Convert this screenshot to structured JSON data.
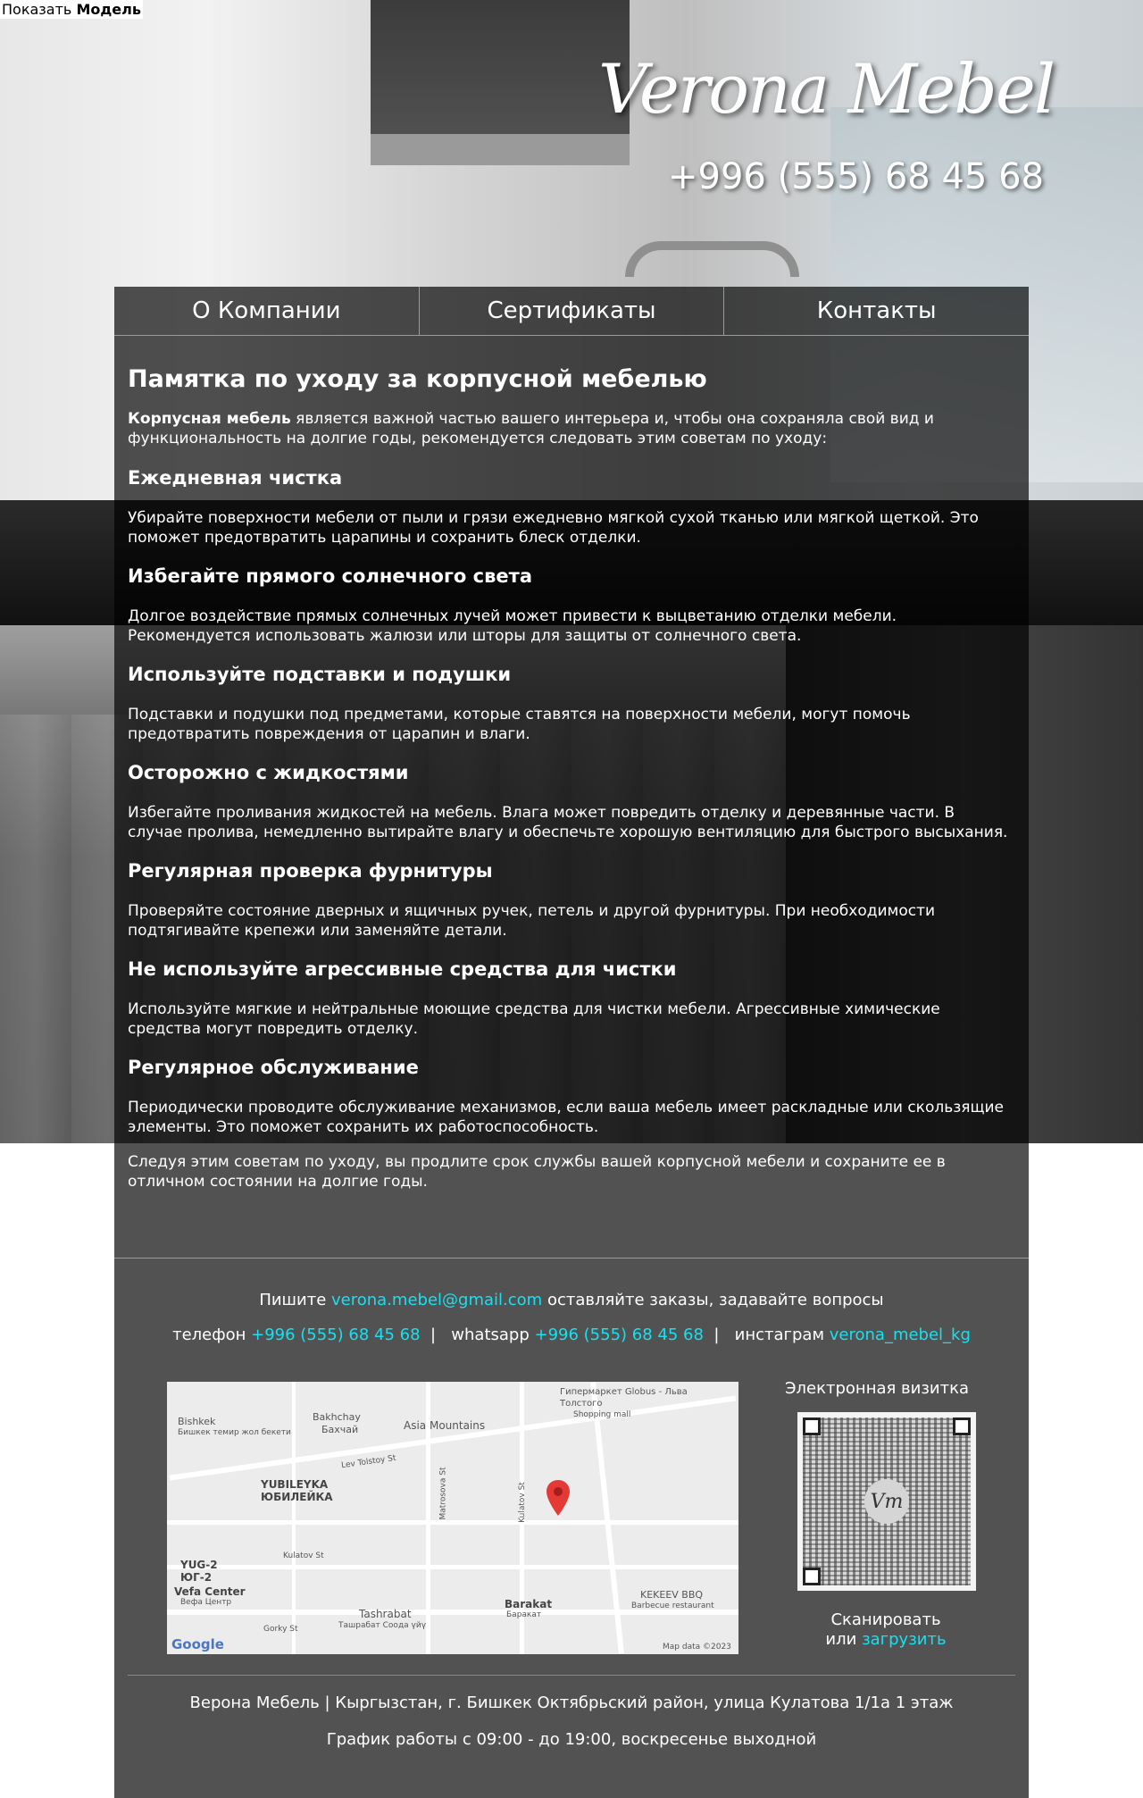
{
  "topbar": {
    "prefix": "Показать",
    "bold": "Модель"
  },
  "header": {
    "logo": "Verona Mebel",
    "phone": "+996 (555) 68 45 68"
  },
  "nav": {
    "items": [
      "О Компании",
      "Сертификаты",
      "Контакты"
    ]
  },
  "article": {
    "title": "Памятка по уходу за корпусной мебелью",
    "intro_bold": "Корпусная мебель",
    "intro_rest": " является важной частью вашего интерьера и, чтобы она сохраняла свой вид и функциональность на долгие годы, рекомендуется следовать этим советам по уходу:",
    "sections": [
      {
        "heading": "Ежедневная чистка",
        "text": "Убирайте поверхности мебели от пыли и грязи ежедневно мягкой сухой тканью или мягкой щеткой. Это поможет предотвратить царапины и сохранить блеск отделки."
      },
      {
        "heading": "Избегайте прямого солнечного света",
        "text": "Долгое воздействие прямых солнечных лучей может привести к выцветанию отделки мебели. Рекомендуется использовать жалюзи или шторы для защиты от солнечного света."
      },
      {
        "heading": "Используйте подставки и подушки",
        "text": "Подставки и подушки под предметами, которые ставятся на поверхности мебели, могут помочь предотвратить повреждения от царапин и влаги."
      },
      {
        "heading": "Осторожно с жидкостями",
        "text": "Избегайте проливания жидкостей на мебель. Влага может повредить отделку и деревянные части. В случае пролива, немедленно вытирайте влагу и обеспечьте хорошую вентиляцию для быстрого высыхания."
      },
      {
        "heading": "Регулярная проверка фурнитуры",
        "text": "Проверяйте состояние дверных и ящичных ручек, петель и другой фурнитуры. При необходимости подтягивайте крепежи или заменяйте детали."
      },
      {
        "heading": "Не используйте агрессивные средства для чистки",
        "text": "Используйте мягкие и нейтральные моющие средства для чистки мебели. Агрессивные химические средства могут повредить отделку."
      },
      {
        "heading": "Регулярное обслуживание",
        "text": "Периодически проводите обслуживание механизмов, если ваша мебель имеет раскладные или скользящие элементы. Это поможет сохранить их работоспособность."
      }
    ],
    "closing": "Следуя этим советам по уходу, вы продлите срок службы вашей корпусной мебели и сохраните ее в отличном состоянии на долгие годы."
  },
  "footer": {
    "write_prefix": "Пишите",
    "email": "verona.mebel@gmail.com",
    "write_suffix": "оставляйте заказы, задавайте вопросы",
    "phone_label": "телефон",
    "phone": "+996 (555) 68 45 68",
    "whatsapp_label": "whatsapp",
    "whatsapp": "+996 (555) 68 45 68",
    "instagram_label": "инстаграм",
    "instagram": "verona_mebel_kg",
    "qr_title": "Электронная визитка",
    "qr_logo": "Vm",
    "scan_line1": "Сканировать",
    "scan_or": "или",
    "scan_link": "загрузить",
    "address": "Верона Мебель | Кыргызстан, г. Бишкек Октябрьский район, улица Кулатова 1/1а 1 этаж",
    "hours": "График работы с 09:00 - до 19:00, воскресенье выходной"
  },
  "map": {
    "labels": [
      "Bishkek",
      "Бишкек темир жол бекети",
      "Bakhchay",
      "Бахчай",
      "Asia Mountains",
      "Гипермаркет Globus - Льва Толстого",
      "Shopping mall",
      "Lev Tolstoy St",
      "YUBILEYKA",
      "ЮБИЛЕЙКА",
      "Matrosova St",
      "Kulatov St",
      "Kulatov St",
      "YUG-2",
      "ЮГ-2",
      "Vefa Center",
      "Вефа Центр",
      "Tashrabat",
      "Ташрабат Соода үйү",
      "Barakat",
      "Баракат",
      "KEKEEV BBQ",
      "Barbecue restaurant",
      "Gorky St",
      "Google",
      "Map data ©2023"
    ]
  }
}
